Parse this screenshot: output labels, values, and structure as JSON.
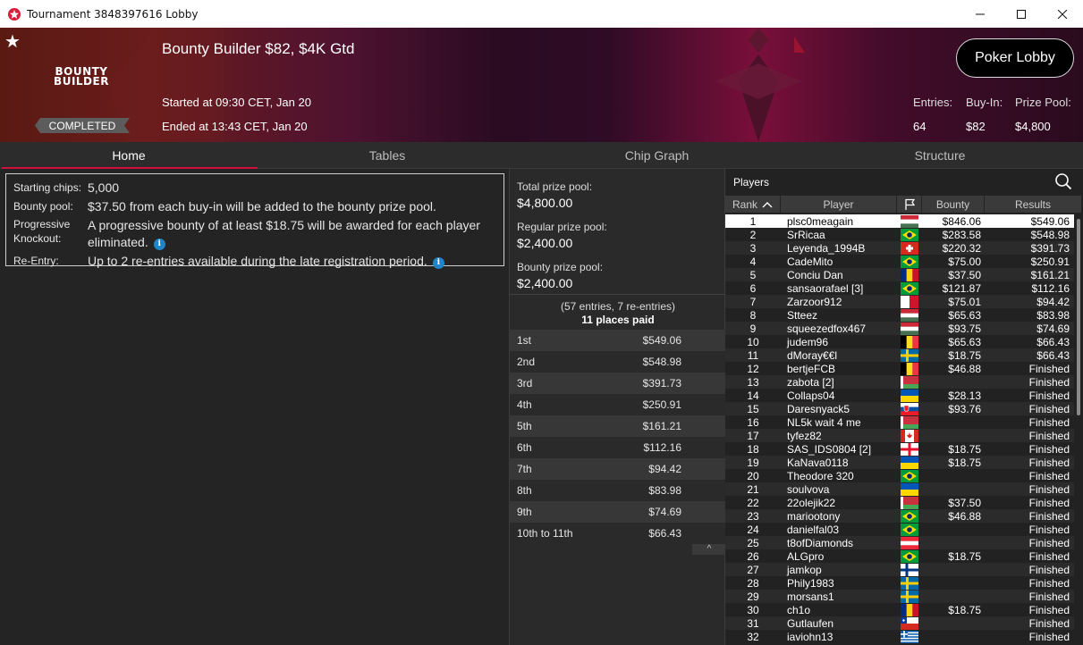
{
  "window": {
    "title": "Tournament 3848397616 Lobby"
  },
  "banner": {
    "logo_line1": "BOUNTY",
    "logo_line2": "BUILDER",
    "status": "COMPLETED",
    "name": "Bounty Builder $82, $4K Gtd",
    "started": "Started at 09:30 CET, Jan 20",
    "ended": "Ended at 13:43 CET, Jan 20",
    "poker_lobby_label": "Poker Lobby",
    "entries_label": "Entries:",
    "entries_value": "64",
    "buyin_label": "Buy-In:",
    "buyin_value": "$82",
    "prizepool_label": "Prize Pool:",
    "prizepool_value": "$4,800"
  },
  "tabs": [
    {
      "label": "Home",
      "active": true
    },
    {
      "label": "Tables"
    },
    {
      "label": "Chip Graph"
    },
    {
      "label": "Structure"
    }
  ],
  "info": {
    "starting_chips_label": "Starting chips:",
    "starting_chips_value": "5,000",
    "bounty_pool_label": "Bounty pool:",
    "bounty_pool_value": "$37.50 from each buy-in will be added to the bounty prize pool.",
    "pko_label_1": "Progressive",
    "pko_label_2": "Knockout:",
    "pko_value_1": "A progressive bounty of at least $18.75 will be awarded for each player",
    "pko_value_2": "eliminated.",
    "reentry_label": "Re-Entry:",
    "reentry_value": "Up to 2 re-entries available during the late registration period.",
    "info_glyph": "i"
  },
  "prize": {
    "total_label": "Total prize pool:",
    "total_value": "$4,800.00",
    "regular_label": "Regular prize pool:",
    "regular_value": "$2,400.00",
    "bounty_label": "Bounty prize pool:",
    "bounty_value": "$2,400.00",
    "entries_note": "(57 entries, 7 re-entries)",
    "places_paid": "11 places paid",
    "payouts": [
      [
        "1st",
        "$549.06"
      ],
      [
        "2nd",
        "$548.98"
      ],
      [
        "3rd",
        "$391.73"
      ],
      [
        "4th",
        "$250.91"
      ],
      [
        "5th",
        "$161.21"
      ],
      [
        "6th",
        "$112.16"
      ],
      [
        "7th",
        "$94.42"
      ],
      [
        "8th",
        "$83.98"
      ],
      [
        "9th",
        "$74.69"
      ],
      [
        "10th to 11th",
        "$66.43"
      ]
    ],
    "collapse_glyph": "^"
  },
  "players": {
    "title": "Players",
    "headers": {
      "rank": "Rank",
      "player": "Player",
      "bounty": "Bounty",
      "results": "Results"
    },
    "rows": [
      [
        "1",
        "plsc0meagain",
        "hungary",
        "$846.06",
        "$549.06"
      ],
      [
        "2",
        "SrRicaa",
        "brazil",
        "$283.58",
        "$548.98"
      ],
      [
        "3",
        "Leyenda_1994B",
        "switzerland",
        "$220.32",
        "$391.73"
      ],
      [
        "4",
        "CadeMito",
        "brazil",
        "$75.00",
        "$250.91"
      ],
      [
        "5",
        "Conciu Dan",
        "romania",
        "$37.50",
        "$161.21"
      ],
      [
        "6",
        "sansaorafael [3]",
        "brazil",
        "$121.87",
        "$112.16"
      ],
      [
        "7",
        "Zarzoor912",
        "malta",
        "$75.01",
        "$94.42"
      ],
      [
        "8",
        "Stteez",
        "hungary",
        "$65.63",
        "$83.98"
      ],
      [
        "9",
        "squeezedfox467",
        "hungary",
        "$93.75",
        "$74.69"
      ],
      [
        "10",
        "judem96",
        "belgium",
        "$65.63",
        "$66.43"
      ],
      [
        "11",
        "dMoray€€l",
        "sweden",
        "$18.75",
        "$66.43"
      ],
      [
        "12",
        "bertjeFCB",
        "belgium",
        "$46.88",
        "Finished"
      ],
      [
        "13",
        "zabota [2]",
        "belarus",
        "",
        "Finished"
      ],
      [
        "14",
        "Collaps04",
        "ukraine",
        "$28.13",
        "Finished"
      ],
      [
        "15",
        "Daresnyack5",
        "slovakia",
        "$93.76",
        "Finished"
      ],
      [
        "16",
        "NL5k wait 4 me",
        "belarus",
        "",
        "Finished"
      ],
      [
        "17",
        "tyfez82",
        "canada",
        "",
        "Finished"
      ],
      [
        "18",
        "SAS_IDS0804 [2]",
        "georgia",
        "$18.75",
        "Finished"
      ],
      [
        "19",
        "KaNava0118",
        "ukraine",
        "$18.75",
        "Finished"
      ],
      [
        "20",
        "Theodore 320",
        "brazil",
        "",
        "Finished"
      ],
      [
        "21",
        "soulvova",
        "ukraine",
        "",
        "Finished"
      ],
      [
        "22",
        "22olejik22",
        "belarus",
        "$37.50",
        "Finished"
      ],
      [
        "23",
        "mariootony",
        "brazil",
        "$46.88",
        "Finished"
      ],
      [
        "24",
        "danielfal03",
        "brazil",
        "",
        "Finished"
      ],
      [
        "25",
        "t8ofDiamonds",
        "austria",
        "",
        "Finished"
      ],
      [
        "26",
        "ALGpro",
        "brazil",
        "$18.75",
        "Finished"
      ],
      [
        "27",
        "jamkop",
        "finland",
        "",
        "Finished"
      ],
      [
        "28",
        "Phily1983",
        "sweden",
        "",
        "Finished"
      ],
      [
        "29",
        "morsans1",
        "sweden",
        "",
        "Finished"
      ],
      [
        "30",
        "ch1o",
        "romania",
        "$18.75",
        "Finished"
      ],
      [
        "31",
        "Gutlaufen",
        "chile",
        "",
        "Finished"
      ],
      [
        "32",
        "iaviohn13",
        "greece",
        "",
        "Finished"
      ]
    ]
  },
  "colors": {
    "accent": "#d0103a",
    "info": "#1e86c8"
  }
}
